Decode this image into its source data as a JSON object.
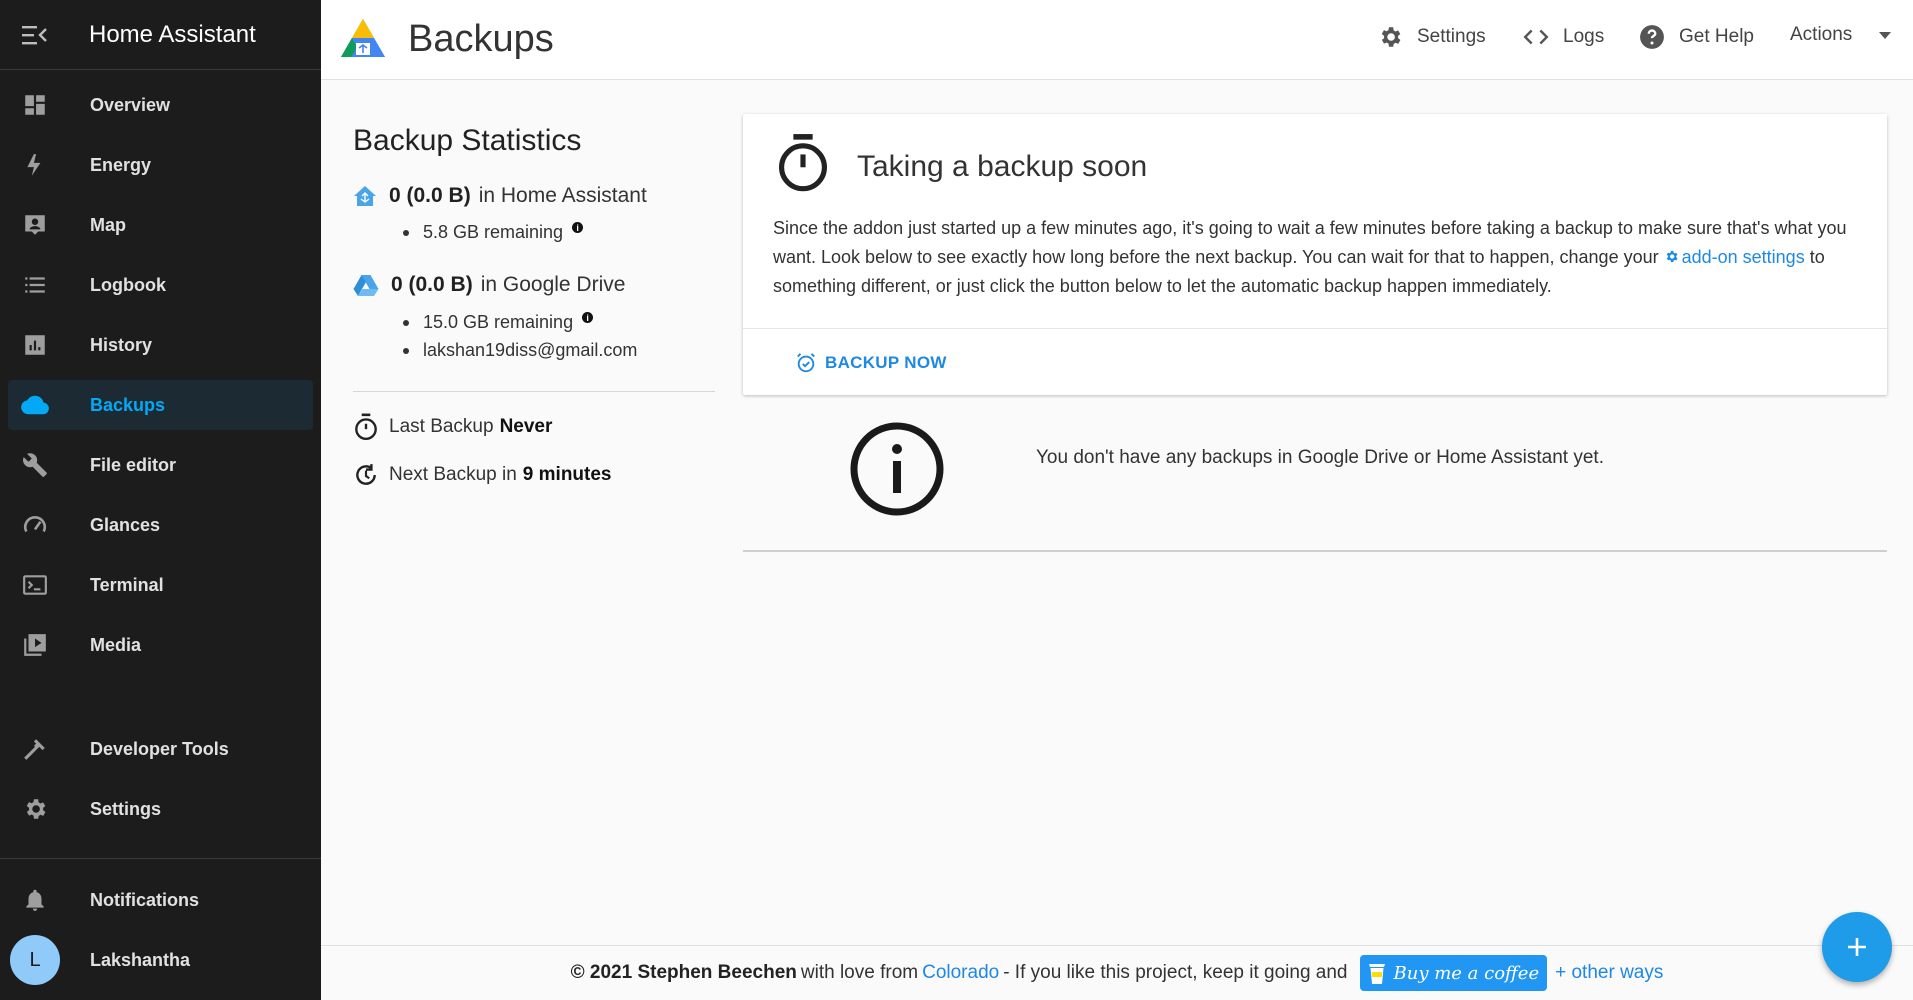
{
  "sidebar": {
    "title": "Home Assistant",
    "items": [
      {
        "label": "Overview",
        "icon": "dashboard-icon"
      },
      {
        "label": "Energy",
        "icon": "lightning-icon"
      },
      {
        "label": "Map",
        "icon": "map-account-icon"
      },
      {
        "label": "Logbook",
        "icon": "list-icon"
      },
      {
        "label": "History",
        "icon": "chart-box-icon"
      },
      {
        "label": "Backups",
        "icon": "cloud-icon",
        "active": true
      },
      {
        "label": "File editor",
        "icon": "wrench-icon"
      },
      {
        "label": "Glances",
        "icon": "gauge-icon"
      },
      {
        "label": "Terminal",
        "icon": "console-icon"
      },
      {
        "label": "Media",
        "icon": "play-box-icon"
      }
    ],
    "developer_tools": "Developer Tools",
    "settings": "Settings",
    "notifications": "Notifications",
    "user": {
      "initial": "L",
      "name": "Lakshantha"
    }
  },
  "topbar": {
    "title": "Backups",
    "settings": "Settings",
    "logs": "Logs",
    "help": "Get Help",
    "actions": "Actions"
  },
  "stats": {
    "title": "Backup Statistics",
    "ha": {
      "count": "0 (0.0 B)",
      "where": "in Home Assistant",
      "remaining": "5.8 GB remaining"
    },
    "gd": {
      "count": "0 (0.0 B)",
      "where": "in Google Drive",
      "remaining": "15.0 GB remaining",
      "account": "lakshan19diss@gmail.com"
    },
    "last_label": "Last Backup",
    "last_value": "Never",
    "next_label": "Next Backup in",
    "next_value": "9 minutes"
  },
  "card": {
    "title": "Taking a backup soon",
    "body_1": "Since the addon just started up a few minutes ago, it's going to wait a few minutes before taking a backup to make sure that's what you want. Look below to see exactly how long before the next backup. You can wait for that to happen, change your ",
    "link": "add-on settings",
    "body_2": " to something different, or just click the button below to let the automatic backup happen immediately.",
    "action": "BACKUP NOW"
  },
  "empty": "You don't have any backups in Google Drive or Home Assistant yet.",
  "footer": {
    "copyright": "© 2021 Stephen Beechen",
    "love": "with love from",
    "place": "Colorado",
    "cta": "- If you like this project, keep it going and",
    "coffee": "Buy me a coffee",
    "other": "+ other ways"
  },
  "colors": {
    "accent": "#03a9f4",
    "link": "#1e88e5",
    "sidebar_bg": "#1c1c1c"
  }
}
